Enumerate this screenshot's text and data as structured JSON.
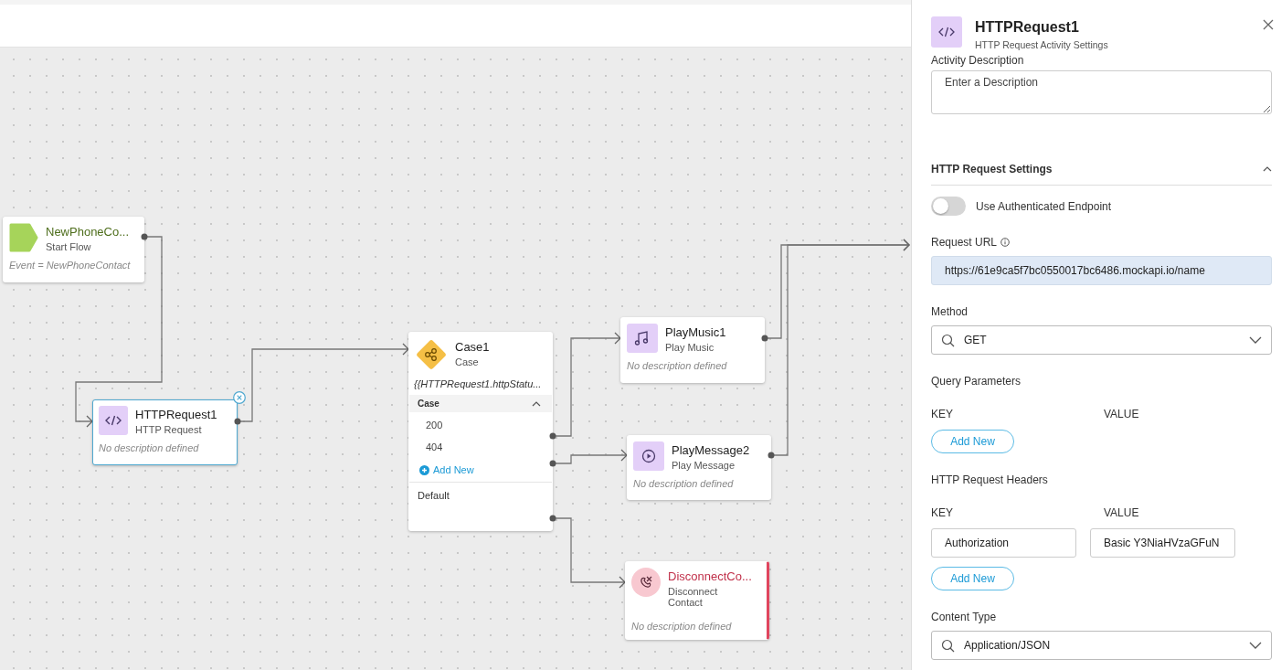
{
  "canvas": {
    "nodes": [
      {
        "kind": "start",
        "title": "NewPhoneCo...",
        "subtitle": "Start Flow",
        "description": "Event = NewPhoneContact",
        "selected": false
      },
      {
        "kind": "http",
        "title": "HTTPRequest1",
        "subtitle": "HTTP Request",
        "description": "No description defined",
        "selected": true
      },
      {
        "kind": "case",
        "title": "Case1",
        "subtitle": "Case",
        "expression": "{{HTTPRequest1.httpStatu...",
        "section": {
          "label": "Case",
          "expanded": true
        },
        "cases": [
          "200",
          "404"
        ],
        "add_label": "Add New",
        "default_label": "Default",
        "selected": false
      },
      {
        "kind": "music",
        "title": "PlayMusic1",
        "subtitle": "Play Music",
        "description": "No description defined",
        "selected": false
      },
      {
        "kind": "message",
        "title": "PlayMessage2",
        "subtitle": "Play Message",
        "description": "No description defined",
        "selected": false
      },
      {
        "kind": "disconnect",
        "title": "DisconnectCo...",
        "subtitle": "Disconnect Contact",
        "description": "No description defined",
        "selected": false
      }
    ]
  },
  "panel": {
    "title": "HTTPRequest1",
    "subtitle": "HTTP Request Activity Settings",
    "description_label": "Activity Description",
    "description_placeholder": "Enter a Description",
    "section": {
      "title": "HTTP Request Settings",
      "expanded": true
    },
    "auth_toggle": {
      "label": "Use Authenticated Endpoint",
      "on": false
    },
    "url": {
      "label": "Request URL",
      "value": "https://61e9ca5f7bc0550017bc6486.mockapi.io/name"
    },
    "method": {
      "label": "Method",
      "value": "GET"
    },
    "query": {
      "label": "Query Parameters",
      "key_heading": "KEY",
      "value_heading": "VALUE",
      "add_label": "Add New"
    },
    "headers": {
      "label": "HTTP Request Headers",
      "key_heading": "KEY",
      "value_heading": "VALUE",
      "rows": [
        {
          "key": "Authorization",
          "value": "Basic Y3NiaHVzaGFuN"
        }
      ],
      "add_label": "Add New"
    },
    "content_type": {
      "label": "Content Type",
      "value": "Application/JSON"
    }
  }
}
